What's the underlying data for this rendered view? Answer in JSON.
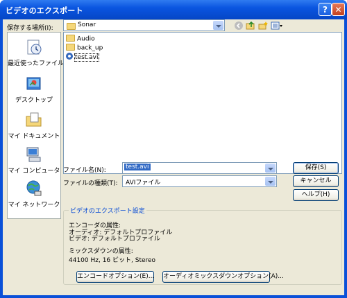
{
  "window": {
    "title": "ビデオのエクスポート"
  },
  "save_location": {
    "label": "保存する場所(I):",
    "value": "Sonar"
  },
  "places": [
    {
      "label": "最近使ったファイル",
      "icon": "recent-documents-icon"
    },
    {
      "label": "デスクトップ",
      "icon": "desktop-icon"
    },
    {
      "label": "マイ ドキュメント",
      "icon": "my-documents-icon"
    },
    {
      "label": "マイ コンピュータ",
      "icon": "my-computer-icon"
    },
    {
      "label": "マイ ネットワーク",
      "icon": "my-network-icon"
    }
  ],
  "files": [
    {
      "name": "Audio",
      "type": "folder"
    },
    {
      "name": "back_up",
      "type": "folder"
    },
    {
      "name": "test.avi",
      "type": "avi"
    }
  ],
  "filename": {
    "label": "ファイル名(N):",
    "value": "test.avi"
  },
  "filetype": {
    "label": "ファイルの種類(T):",
    "value": "AVIファイル"
  },
  "buttons": {
    "save": "保存(S)",
    "cancel": "キャンセル",
    "help": "ヘルプ(H)"
  },
  "settings": {
    "title": "ビデオのエクスポート設定",
    "encoder_heading": "エンコーダの属性:",
    "audio_line": "オーディオ: デフォルトプロファイル",
    "video_line": "ビデオ: デフォルトプロファイル",
    "mixdown_heading": "ミックスダウンの属性:",
    "mixdown_value": "44100 Hz, 16 ビット, Stereo",
    "encode_options": "エンコードオプション(E)...",
    "audio_mix_options": "オーディオミックスダウンオプション(A)..."
  }
}
